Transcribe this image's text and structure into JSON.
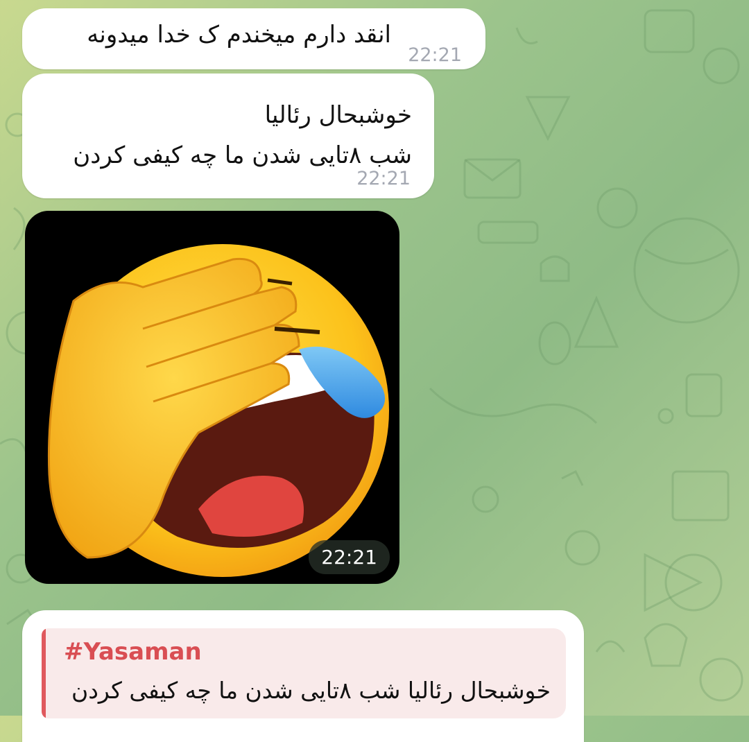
{
  "messages": [
    {
      "text": "انقد دارم میخندم ک خدا میدونه",
      "time": "22:21"
    },
    {
      "lines": [
        "خوشبحال رئالیا",
        "شب ۸تایی شدن ما چه کیفی کردن"
      ],
      "time": "22:21"
    },
    {
      "media": "facepalm-laughing-emoji",
      "time": "22:21"
    }
  ],
  "reply": {
    "sender": "#Yasaman",
    "quote": "خوشبحال رئالیا شب ۸تایی شدن ما چه کیفی کردن"
  },
  "colors": {
    "bubble": "#ffffff",
    "timestamp": "#a4a8b2",
    "reply_accent": "#e0595d",
    "reply_name": "#d94e53",
    "reply_bg": "#f9eaea"
  }
}
